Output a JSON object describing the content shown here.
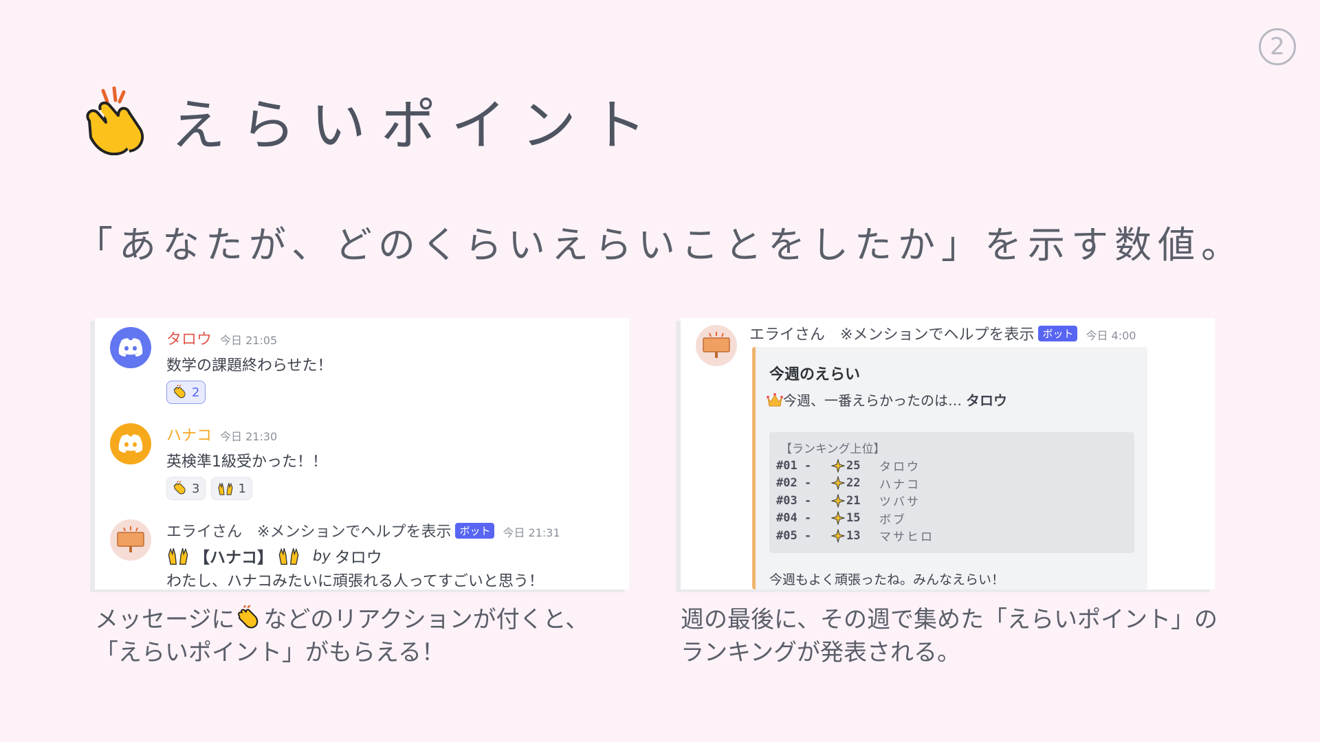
{
  "page": {
    "number": "2",
    "title": "えらいポイント",
    "subtitle": "「あなたが、どのくらいえらいことをしたか」を示す数値。",
    "title_icon": "clapping-hands-icon"
  },
  "left_panel": {
    "messages": [
      {
        "username": "タロウ",
        "username_color": "#e0584c",
        "timestamp": "今日 21:05",
        "text": "数学の課題終わらせた！",
        "reactions": [
          {
            "icon": "clapping-hands-icon",
            "count": "2",
            "active": true
          }
        ]
      },
      {
        "username": "ハナコ",
        "username_color": "#f5a623",
        "timestamp": "今日 21:30",
        "text": "英検準1級受かった！！",
        "reactions": [
          {
            "icon": "clapping-hands-icon",
            "count": "3",
            "active": false
          },
          {
            "icon": "raising-hands-icon",
            "count": "1",
            "active": false
          }
        ]
      },
      {
        "username": "エライさん",
        "bot_note": "※メンションでヘルプを表示",
        "bot_tag": "ボット",
        "timestamp": "今日 21:31",
        "praise_name": "【ハナコ】",
        "by_label": "by",
        "by_name": "タロウ",
        "text": "わたし、ハナコみたいに頑張れる人ってすごいと思う！"
      }
    ],
    "caption_line1_before": "メッセージに",
    "caption_line1_after": "などのリアクションが付くと、",
    "caption_line2": "「えらいポイント」がもらえる！"
  },
  "right_panel": {
    "username": "エライさん",
    "bot_note": "※メンションでヘルプを表示",
    "bot_tag": "ボット",
    "timestamp": "今日 4:00",
    "embed": {
      "title": "今週のえらい",
      "desc_prefix": "今週、一番えらかったのは…",
      "desc_name": "タロウ",
      "ranking_header": "【ランキング上位】",
      "ranking": [
        {
          "rank": "#01 -",
          "score": "25",
          "name": "タロウ"
        },
        {
          "rank": "#02 -",
          "score": "22",
          "name": "ハナコ"
        },
        {
          "rank": "#03 -",
          "score": "21",
          "name": "ツバサ"
        },
        {
          "rank": "#04 -",
          "score": "15",
          "name": "ボブ"
        },
        {
          "rank": "#05 -",
          "score": "13",
          "name": "マサヒロ"
        }
      ],
      "footer": "今週もよく頑張ったね。みんなえらい！"
    },
    "caption_line1": "週の最後に、その週で集めた「えらいポイント」の",
    "caption_line2": "ランキングが発表される。"
  },
  "colors": {
    "background": "#fcf2f8",
    "discord_blurple": "#5865f2",
    "embed_accent": "#f0b46e"
  }
}
